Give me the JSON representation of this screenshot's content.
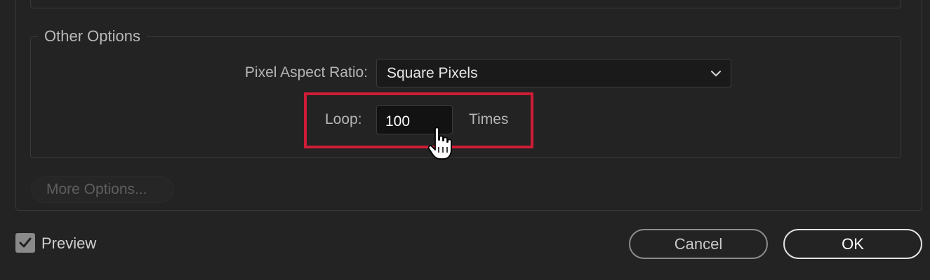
{
  "other_options": {
    "title": "Other Options",
    "pixel_aspect_ratio": {
      "label": "Pixel Aspect Ratio:",
      "value": "Square Pixels",
      "icon": "chevron-down-icon"
    },
    "loop": {
      "label": "Loop:",
      "value": "100",
      "unit": "Times"
    }
  },
  "more_options_label": "More Options...",
  "preview": {
    "label": "Preview",
    "checked": true
  },
  "buttons": {
    "cancel": "Cancel",
    "ok": "OK"
  },
  "colors": {
    "background": "#232323",
    "highlight_border": "#d01c36",
    "input_background": "#121212"
  }
}
